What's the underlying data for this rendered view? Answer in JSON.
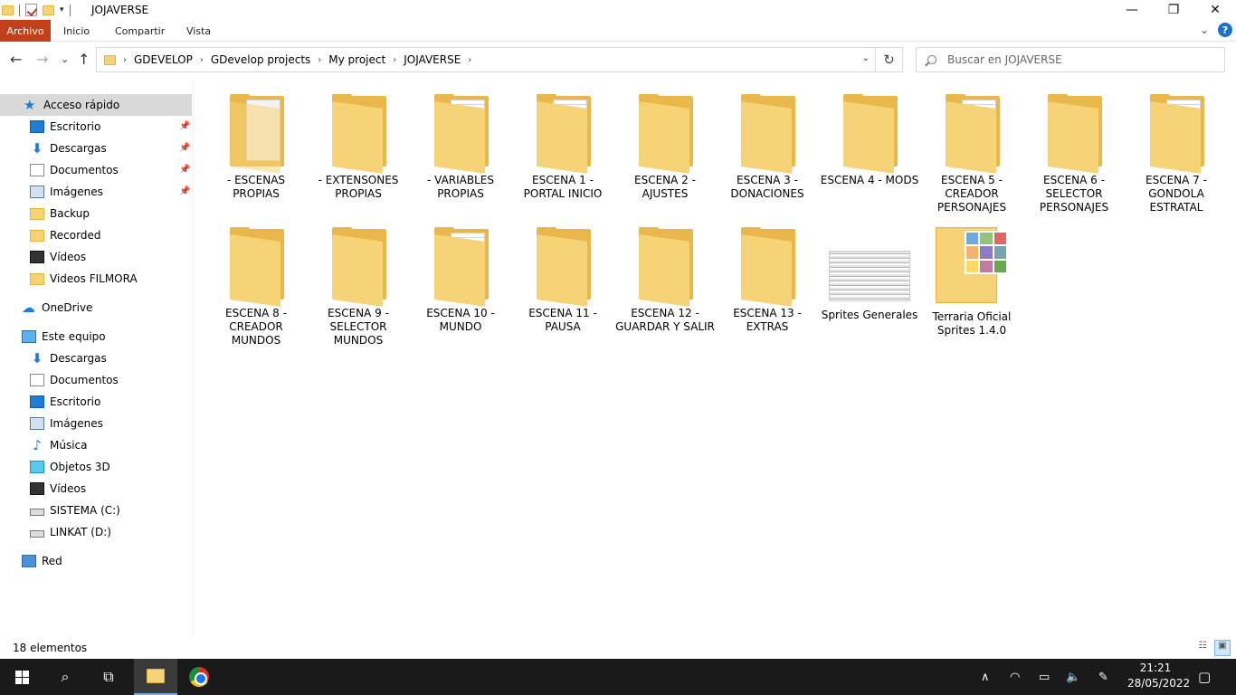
{
  "window": {
    "title": "JOJAVERSE",
    "min": "—",
    "max": "❐",
    "close": "✕"
  },
  "ribbon": {
    "tabs": [
      "Archivo",
      "Inicio",
      "Compartir",
      "Vista"
    ],
    "expand": "⌄",
    "help": "?"
  },
  "nav": {
    "back": "←",
    "forward": "→",
    "recent": "⌄",
    "up": "↑",
    "breadcrumb": [
      "GDEVELOP",
      "GDevelop projects",
      "My project",
      "JOJAVERSE"
    ],
    "search_placeholder": "Buscar en JOJAVERSE"
  },
  "sidebar": {
    "quick_access": "Acceso rápido",
    "quick_items": [
      "Escritorio",
      "Descargas",
      "Documentos",
      "Imágenes",
      "Backup",
      "Recorded",
      "Vídeos",
      "Videos FILMORA"
    ],
    "onedrive": "OneDrive",
    "this_pc": "Este equipo",
    "pc_items": [
      "Descargas",
      "Documentos",
      "Escritorio",
      "Imágenes",
      "Música",
      "Objetos 3D",
      "Vídeos",
      "SISTEMA (C:)",
      "LINKAT (D:)"
    ],
    "network": "Red"
  },
  "files": [
    {
      "name": "- ESCENAS PROPIAS",
      "icon": "folder-white"
    },
    {
      "name": "- EXTENSONES PROPIAS",
      "icon": "folder"
    },
    {
      "name": "- VARIABLES PROPIAS",
      "icon": "folder-doc"
    },
    {
      "name": "ESCENA 1 - PORTAL INICIO",
      "icon": "folder-doc"
    },
    {
      "name": "ESCENA 2 - AJUSTES",
      "icon": "folder"
    },
    {
      "name": "ESCENA 3 - DONACIONES",
      "icon": "folder"
    },
    {
      "name": "ESCENA 4 - MODS",
      "icon": "folder"
    },
    {
      "name": "ESCENA 5 - CREADOR PERSONAJES",
      "icon": "folder-doc"
    },
    {
      "name": "ESCENA 6 - SELECTOR PERSONAJES",
      "icon": "folder"
    },
    {
      "name": "ESCENA 7 - GONDOLA ESTRATAL",
      "icon": "folder-doc"
    },
    {
      "name": "ESCENA 8 - CREADOR MUNDOS",
      "icon": "folder"
    },
    {
      "name": "ESCENA 9 - SELECTOR MUNDOS",
      "icon": "folder"
    },
    {
      "name": "ESCENA 10 - MUNDO",
      "icon": "folder-doc"
    },
    {
      "name": "ESCENA 11 - PAUSA",
      "icon": "folder"
    },
    {
      "name": "ESCENA 12 - GUARDAR Y SALIR",
      "icon": "folder"
    },
    {
      "name": "ESCENA 13 - EXTRAS",
      "icon": "folder"
    },
    {
      "name": "Sprites Generales",
      "icon": "image-thumb"
    },
    {
      "name": "Terraria Oficial Sprites 1.4.0",
      "icon": "folder-images"
    }
  ],
  "status": {
    "count": "18 elementos"
  },
  "taskbar": {
    "time": "21:21",
    "date": "28/05/2022"
  },
  "colors": {
    "archivo_tab": "#c4401b",
    "folder": "#f6d377",
    "accent": "#1e7dd6"
  }
}
